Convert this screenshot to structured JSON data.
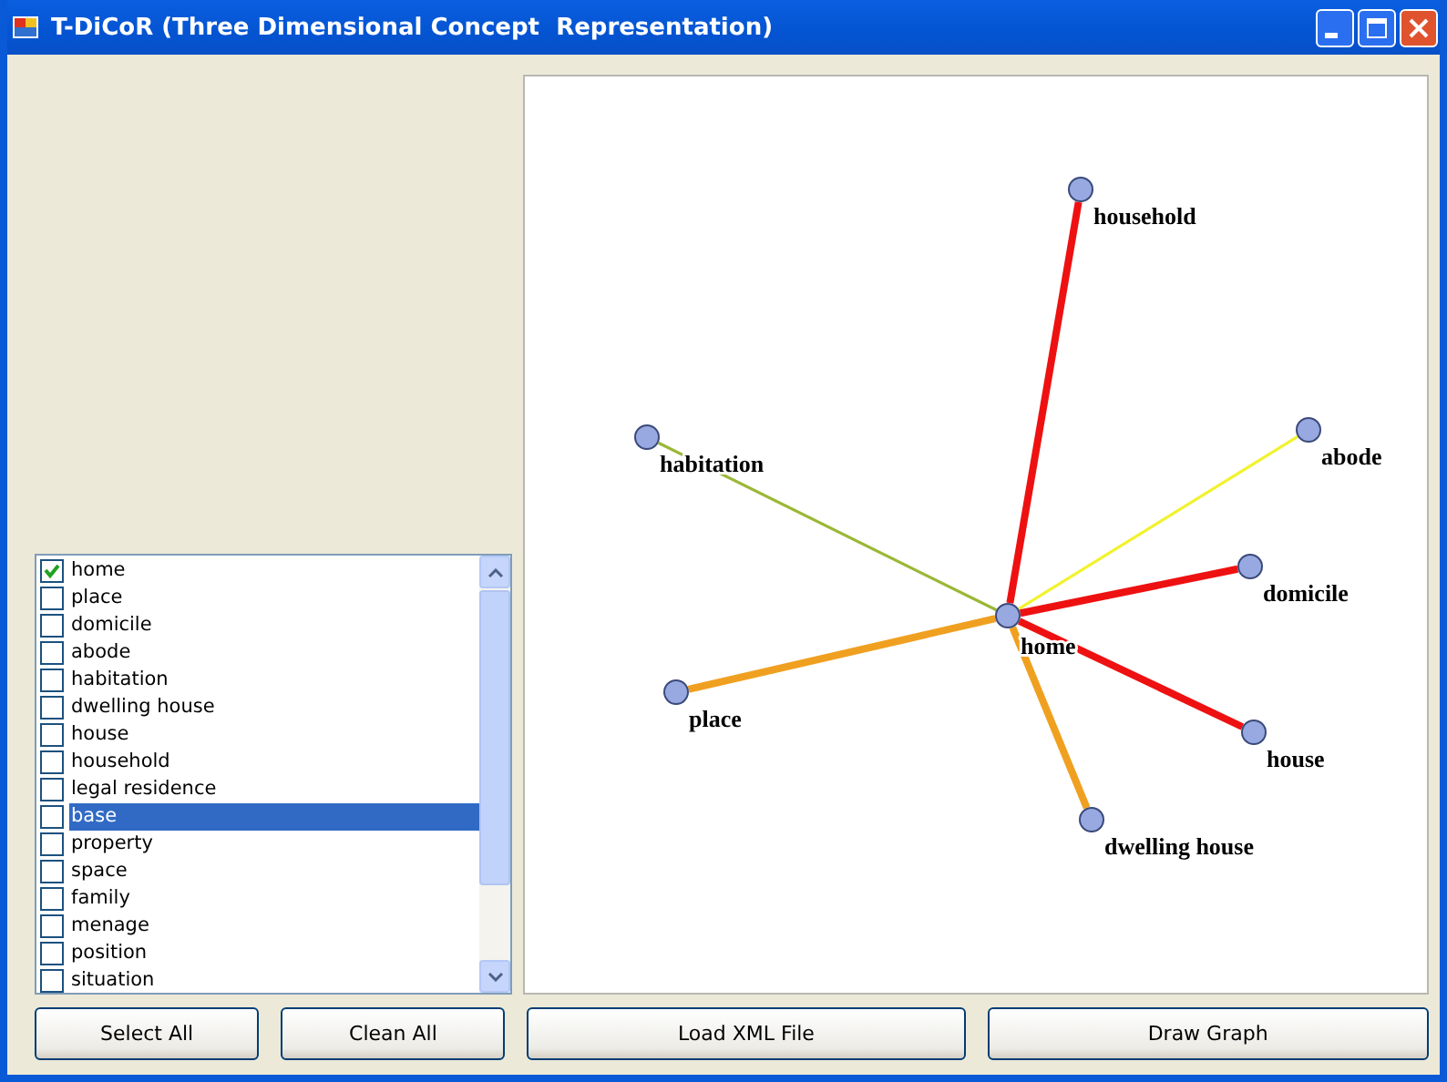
{
  "window": {
    "title": "T-DiCoR (Three Dimensional Concept  Representation)"
  },
  "words": [
    {
      "label": "home",
      "checked": true,
      "selected": false
    },
    {
      "label": "place",
      "checked": false,
      "selected": false
    },
    {
      "label": "domicile",
      "checked": false,
      "selected": false
    },
    {
      "label": "abode",
      "checked": false,
      "selected": false
    },
    {
      "label": "habitation",
      "checked": false,
      "selected": false
    },
    {
      "label": "dwelling house",
      "checked": false,
      "selected": false
    },
    {
      "label": "house",
      "checked": false,
      "selected": false
    },
    {
      "label": "household",
      "checked": false,
      "selected": false
    },
    {
      "label": "legal residence",
      "checked": false,
      "selected": false
    },
    {
      "label": "base",
      "checked": false,
      "selected": true
    },
    {
      "label": "property",
      "checked": false,
      "selected": false
    },
    {
      "label": "space",
      "checked": false,
      "selected": false
    },
    {
      "label": "family",
      "checked": false,
      "selected": false
    },
    {
      "label": "menage",
      "checked": false,
      "selected": false
    },
    {
      "label": "position",
      "checked": false,
      "selected": false
    },
    {
      "label": "situation",
      "checked": false,
      "selected": false
    }
  ],
  "graph": {
    "center": "home",
    "nodes": [
      {
        "label": "household",
        "color": "#ee1111",
        "thick": true
      },
      {
        "label": "abode",
        "color": "#f2f22e",
        "thick": false
      },
      {
        "label": "habitation",
        "color": "#9ab836",
        "thick": false
      },
      {
        "label": "domicile",
        "color": "#ee1111",
        "thick": true
      },
      {
        "label": "place",
        "color": "#f0a020",
        "thick": true
      },
      {
        "label": "house",
        "color": "#ee1111",
        "thick": true
      },
      {
        "label": "dwelling house",
        "color": "#f0a020",
        "thick": true
      }
    ]
  },
  "buttons": [
    "Select All",
    "Clean All",
    "Load XML File",
    "Draw Graph"
  ]
}
